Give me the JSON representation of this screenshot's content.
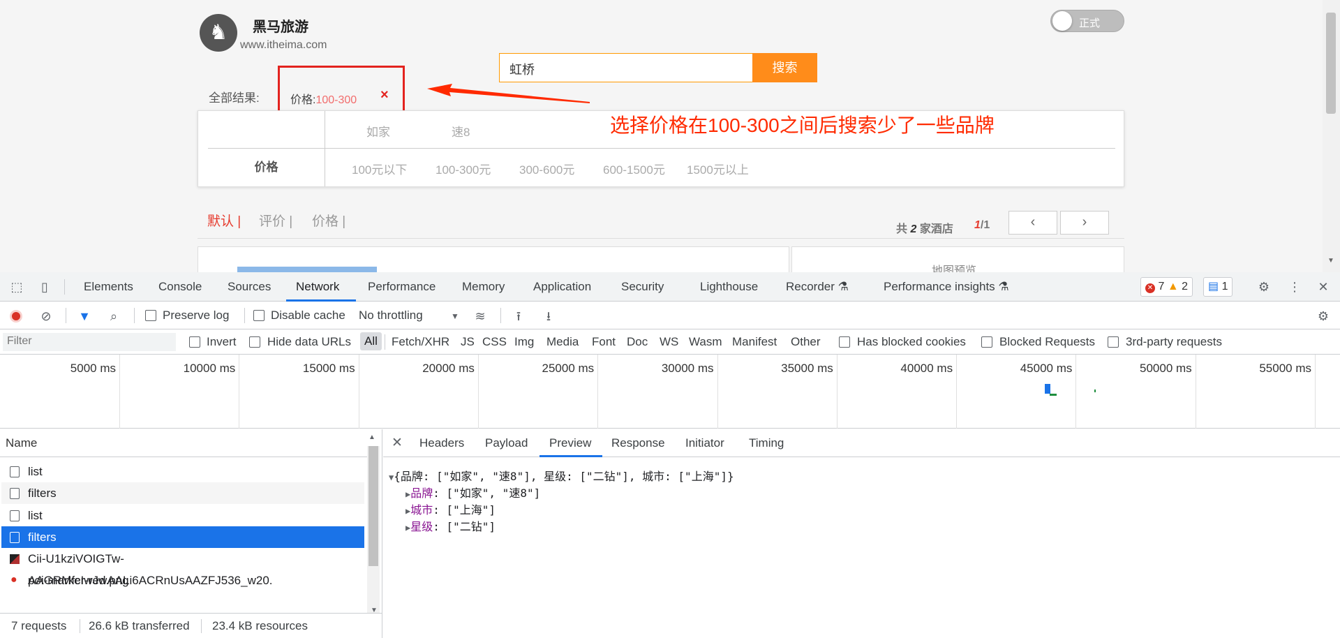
{
  "site": {
    "brand_name": "黑马旅游",
    "brand_url": "www.itheima.com",
    "toggle_label": "正式",
    "search_value": "虹桥",
    "search_button": "搜索",
    "results_label": "全部结果:",
    "active_tag": {
      "label": "价格:",
      "value": "100-300",
      "remove": "×"
    },
    "annotation": "选择价格在100-300之间后搜索少了一些品牌",
    "filters": {
      "brand_options": [
        "如家",
        "速8"
      ],
      "price_head": "价格",
      "price_options": [
        "100元以下",
        "100-300元",
        "300-600元",
        "600-1500元",
        "1500元以上"
      ]
    },
    "sort": [
      "默认",
      "评价",
      "价格"
    ],
    "count": {
      "prefix": "共",
      "num": "2",
      "suffix": "家酒店"
    },
    "pager": {
      "current": "1",
      "total": "/1",
      "prev": "‹",
      "next": "›"
    },
    "map_label": "地图预览"
  },
  "devtools": {
    "tabs": [
      "Elements",
      "Console",
      "Sources",
      "Network",
      "Performance",
      "Memory",
      "Application",
      "Security",
      "Lighthouse",
      "Recorder",
      "Performance insights"
    ],
    "badges": {
      "errors": "7",
      "warnings": "2",
      "messages": "1"
    },
    "toolbar": {
      "preserve_log": "Preserve log",
      "disable_cache": "Disable cache",
      "throttling": "No throttling"
    },
    "filter": {
      "placeholder": "Filter",
      "invert": "Invert",
      "hide_data_urls": "Hide data URLs",
      "types": [
        "All",
        "Fetch/XHR",
        "JS",
        "CSS",
        "Img",
        "Media",
        "Font",
        "Doc",
        "WS",
        "Wasm",
        "Manifest",
        "Other"
      ],
      "has_blocked_cookies": "Has blocked cookies",
      "blocked_requests": "Blocked Requests",
      "third_party": "3rd-party requests"
    },
    "overview_ticks": [
      "5000 ms",
      "10000 ms",
      "15000 ms",
      "20000 ms",
      "25000 ms",
      "30000 ms",
      "35000 ms",
      "40000 ms",
      "45000 ms",
      "50000 ms",
      "55000 ms"
    ],
    "name_header": "Name",
    "requests": [
      "list",
      "filters",
      "list",
      "filters",
      "Cii-U1kziVOIGTw-AAGRMfcIwJwAALi6ACRnUsAAZFJ536_w20.",
      "poi-marker-red.png"
    ],
    "selected_index": 3,
    "status": {
      "requests": "7 requests",
      "transferred": "26.6 kB transferred",
      "resources": "23.4 kB resources"
    },
    "detail_tabs": [
      "Headers",
      "Payload",
      "Preview",
      "Response",
      "Initiator",
      "Timing"
    ],
    "active_detail_tab": "Preview",
    "preview": {
      "summary": "{品牌: [\"如家\", \"速8\"], 星级: [\"二钻\"], 城市: [\"上海\"]}",
      "lines": [
        {
          "key": "品牌",
          "value": ": [\"如家\", \"速8\"]"
        },
        {
          "key": "城市",
          "value": ": [\"上海\"]"
        },
        {
          "key": "星级",
          "value": ": [\"二钻\"]"
        }
      ]
    },
    "colors": {
      "accent": "#1a73e8",
      "error": "#d93025",
      "warning": "#f29900"
    }
  }
}
